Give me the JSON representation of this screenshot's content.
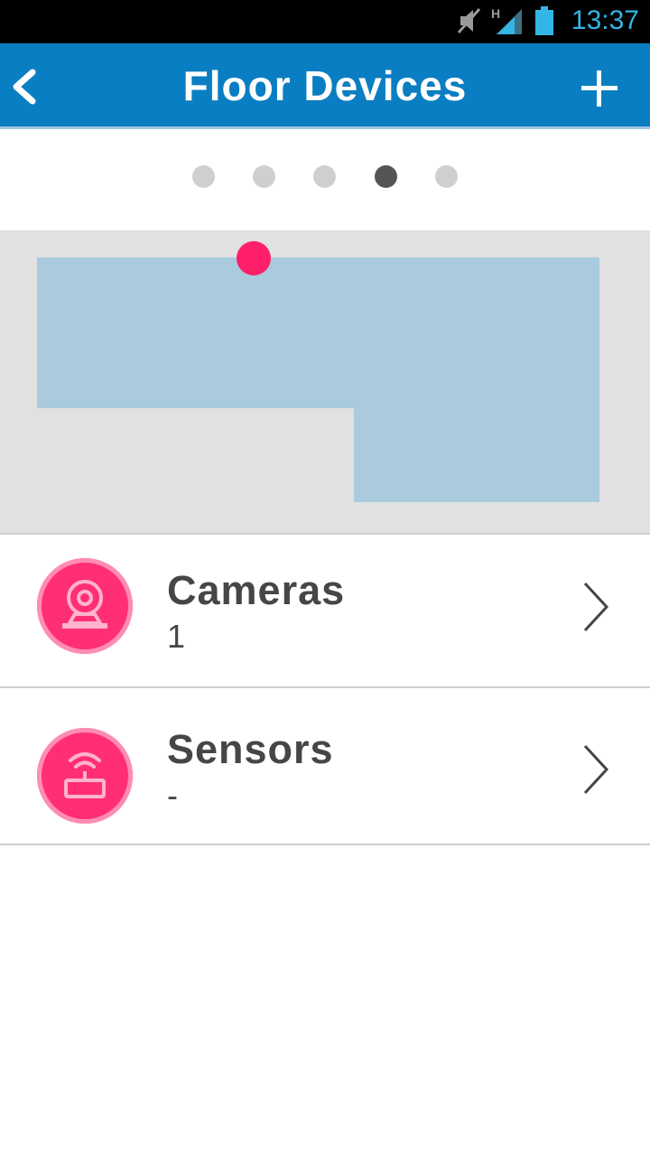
{
  "status_bar": {
    "time": "13:37",
    "icons": [
      "mute-icon",
      "signal-h-icon",
      "battery-icon"
    ]
  },
  "app_bar": {
    "title": "Floor Devices",
    "back_icon": "chevron-left-icon",
    "add_icon": "plus-icon",
    "color": "#0a7ec2"
  },
  "pager": {
    "count": 5,
    "active_index": 3
  },
  "floor_map": {
    "floor_color": "#a9cbdd",
    "background_color": "#e1e1e1",
    "marker_color": "#ff1f6b"
  },
  "devices": [
    {
      "label": "Cameras",
      "count": "1",
      "icon": "camera-icon"
    },
    {
      "label": "Sensors",
      "count": "-",
      "icon": "router-sensor-icon"
    }
  ],
  "colors": {
    "accent": "#ff2e77",
    "text": "#464646"
  }
}
